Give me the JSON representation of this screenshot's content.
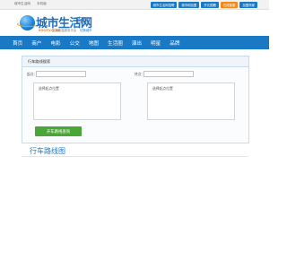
{
  "topbar": {
    "links": [
      "城市生活网",
      "手机版"
    ],
    "right_links": [
      "城市生活网招聘",
      "城市网加盟",
      "开元国籍",
      "加盟商家"
    ],
    "highlight_link": "在线客服"
  },
  "logo": {
    "name": "城市生活网",
    "city": "百色",
    "domain": "0GOTV.COM",
    "slogan": "生活信息服务平台",
    "switch_city": "切换城市"
  },
  "nav": {
    "items": [
      "首页",
      "商户",
      "电影",
      "公交",
      "地图",
      "生活圈",
      "演出",
      "明星",
      "品牌"
    ]
  },
  "search": {
    "panel_title": "行车路线搜索",
    "from_label": "起点：",
    "to_label": "终点：",
    "from_value": "",
    "to_value": "",
    "from_city_hint": "选择起点位置",
    "to_city_hint": "选择起点位置",
    "button_label": "开车路线查询"
  },
  "route": {
    "title": "行车路线图"
  },
  "colors": {
    "brand_blue": "#1a79c4",
    "button_green": "#4aa636",
    "accent_orange": "#f08a1c"
  }
}
